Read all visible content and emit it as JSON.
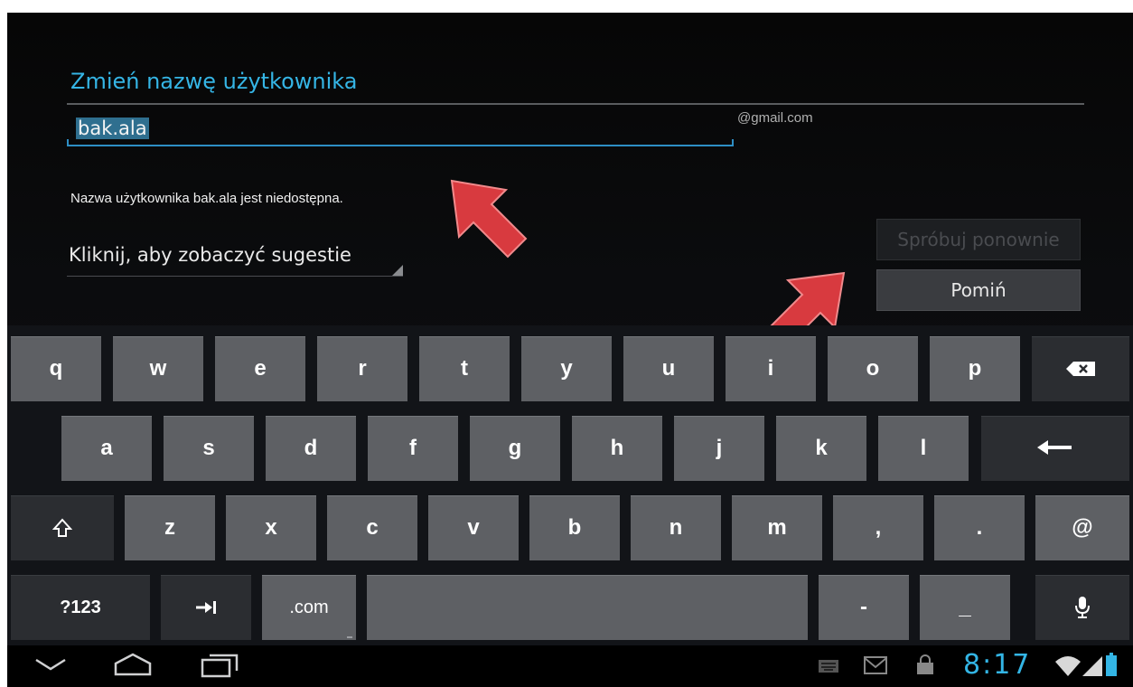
{
  "form": {
    "title": "Zmień nazwę użytkownika",
    "username_value": "bak.ala",
    "domain_suffix": "@gmail.com",
    "error_message": "Nazwa użytkownika bak.ala jest niedostępna.",
    "suggestions_label": "Kliknij, aby zobaczyć sugestie",
    "retry_button": "Spróbuj ponownie",
    "skip_button": "Pomiń"
  },
  "keyboard": {
    "row1": [
      "q",
      "w",
      "e",
      "r",
      "t",
      "y",
      "u",
      "i",
      "o",
      "p"
    ],
    "row2": [
      "a",
      "s",
      "d",
      "f",
      "g",
      "h",
      "j",
      "k",
      "l"
    ],
    "row3": [
      "z",
      "x",
      "c",
      "v",
      "b",
      "n",
      "m",
      ",",
      ".",
      "@"
    ],
    "row4": {
      "symbols": "?123",
      "dotcom": ".com",
      "dash": "-",
      "underscore": "_"
    },
    "icons": [
      "backspace-icon",
      "enter-icon",
      "shift-icon",
      "tab-icon",
      "microphone-icon"
    ]
  },
  "statusbar": {
    "time": "8:17",
    "icons": [
      "keyboard-icon",
      "gmail-icon",
      "lock-icon",
      "wifi-icon",
      "signal-icon",
      "battery-icon"
    ]
  },
  "navbar": {
    "icons": [
      "back-icon",
      "home-icon",
      "recent-apps-icon"
    ]
  },
  "colors": {
    "accent": "#35b5e5",
    "key": "#5e6064",
    "key_dark": "#2b2d31",
    "arrow": "#d83a3f"
  }
}
